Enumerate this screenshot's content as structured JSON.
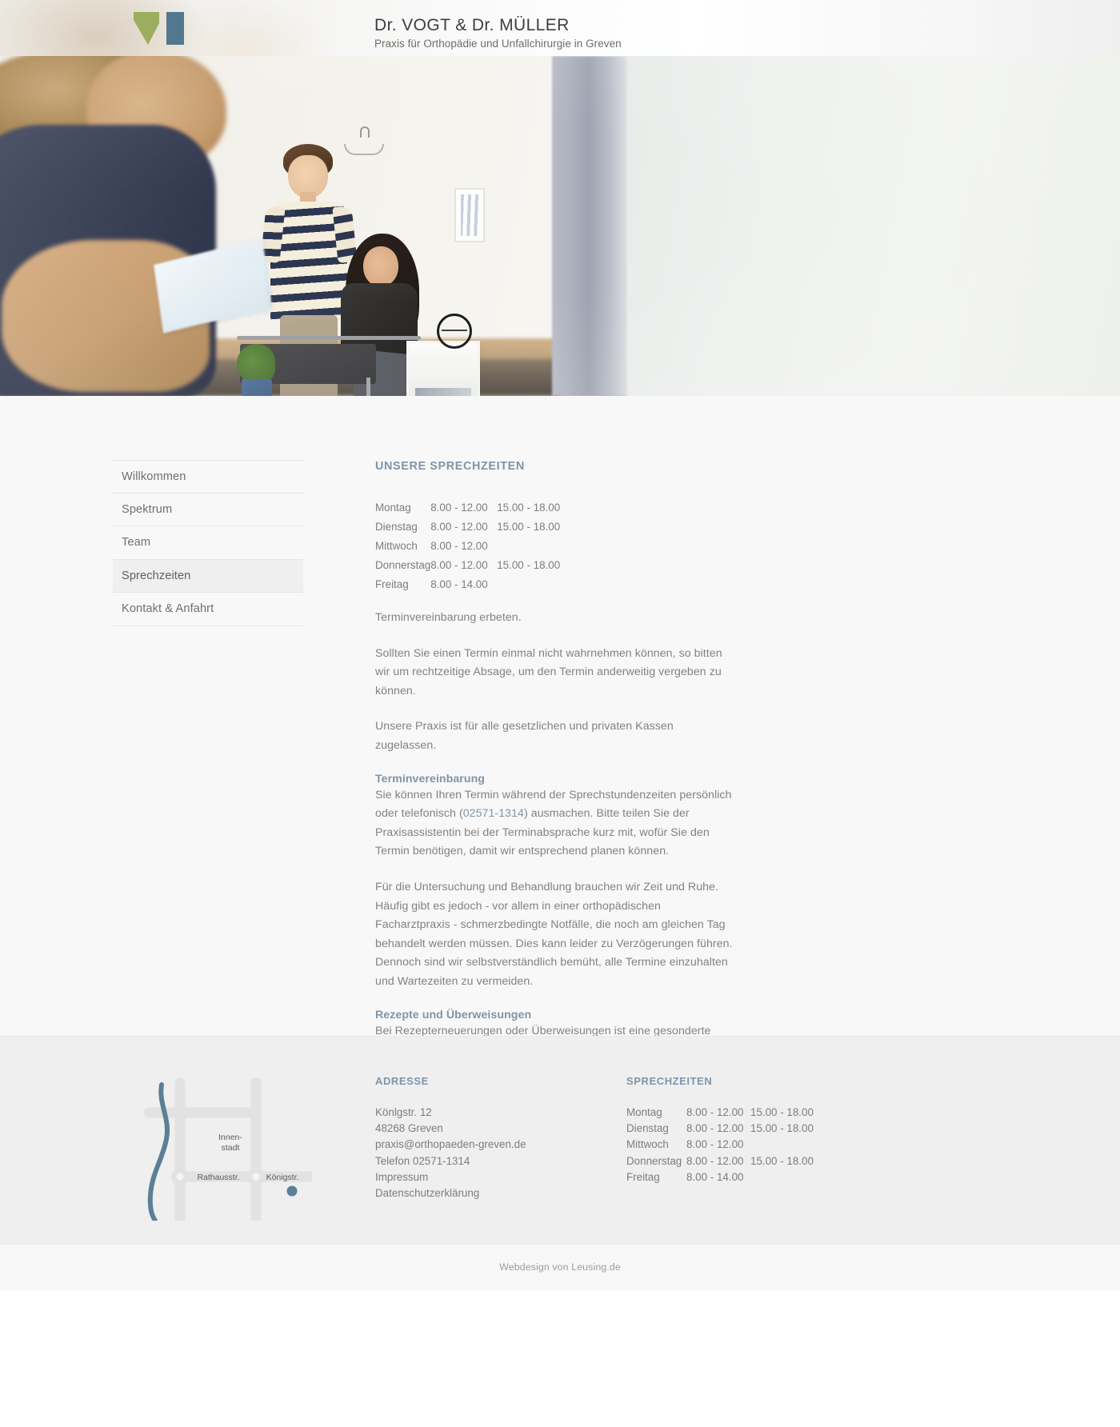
{
  "header": {
    "logo_name": "vogt-mueller-logo",
    "title": "Dr. VOGT  &  Dr. MÜLLER",
    "subtitle": "Praxis für Orthopädie und Unfallchirurgie in Greven"
  },
  "hero": {
    "alt": "Praxisteam begrüßt Patienten im Wartezimmer"
  },
  "sidebar": {
    "items": [
      {
        "label": "Willkommen",
        "active": false
      },
      {
        "label": "Spektrum",
        "active": false
      },
      {
        "label": "Team",
        "active": false
      },
      {
        "label": "Sprechzeiten",
        "active": true
      },
      {
        "label": "Kontakt & Anfahrt",
        "active": false
      }
    ]
  },
  "main": {
    "title": "UNSERE SPRECHZEITEN",
    "hours": [
      {
        "day": "Montag",
        "morning": "8.00 - 12.00",
        "afternoon": "15.00 - 18.00"
      },
      {
        "day": "Dienstag",
        "morning": "8.00 - 12.00",
        "afternoon": "15.00 - 18.00"
      },
      {
        "day": "Mittwoch",
        "morning": "8.00 - 12.00",
        "afternoon": ""
      },
      {
        "day": "Donnerstag",
        "morning": "8.00 - 12.00",
        "afternoon": "15.00 - 18.00"
      },
      {
        "day": "Freitag",
        "morning": "8.00 - 14.00",
        "afternoon": ""
      }
    ],
    "p_appointment_request": "Terminvereinbarung erbeten.",
    "p_cancellation": "Sollten Sie einen Termin einmal nicht wahrnehmen können, so bitten wir um rechtzeitige Absage, um den Termin anderweitig vergeben zu können.",
    "p_insurance": "Unsere Praxis ist für alle gesetzlichen und privaten Kassen zugelassen.",
    "h_terminvereinbarung": "Terminvereinbarung",
    "p_terminvereinbarung_a": "Sie können Ihren Termin während der Sprechstundenzeiten persönlich oder telefonisch (",
    "phone_link": "02571-1314",
    "p_terminvereinbarung_b": ") ausmachen. Bitte teilen Sie der Praxisassistentin bei der Terminabsprache kurz mit, wofür Sie den Termin benötigen, damit wir entsprechend planen können.",
    "p_waiting": "Für die Untersuchung und Behandlung brauchen wir Zeit und Ruhe. Häufig gibt es jedoch - vor allem in einer orthopädischen Facharztpraxis - schmerzbedingte Notfälle, die noch am gleichen Tag behandelt werden müssen. Dies kann leider zu Verzögerungen führen. Dennoch sind wir selbstverständlich bemüht, alle Termine einzuhalten und Wartezeiten zu vermeiden.",
    "h_rezepte": "Rezepte und Überweisungen",
    "p_rezepte_a": "Bei Rezepterneuerungen oder Überweisungen ist eine gesonderte Anmeldung nicht erforderlich. Wir empfehlen jedoch, eine telefonische Vorbestellung (",
    "p_rezepte_b": ")."
  },
  "footer": {
    "map": {
      "label_innenstadt_line1": "Innen-",
      "label_innenstadt_line2": "stadt",
      "label_rathausstr": "Rathausstr.",
      "label_koenigstr": "Königstr.",
      "river_color": "#5b7f96",
      "road_color": "#e2e2e2",
      "marker_color": "#5b7f96"
    },
    "address": {
      "heading": "ADRESSE",
      "street": "Könlgstr. 12",
      "city": "48268 Greven",
      "email": "praxis@orthopaeden-greven.de",
      "phone": "Telefon 02571-1314",
      "impressum": "Impressum",
      "datenschutz": "Datenschutzerklärung"
    },
    "hours": {
      "heading": "SPRECHZEITEN",
      "rows": [
        {
          "day": "Montag",
          "morning": "8.00 - 12.00",
          "afternoon": "15.00 - 18.00"
        },
        {
          "day": "Dienstag",
          "morning": "8.00 - 12.00",
          "afternoon": "15.00 - 18.00"
        },
        {
          "day": "Mittwoch",
          "morning": "8.00 - 12.00",
          "afternoon": ""
        },
        {
          "day": "Donnerstag",
          "morning": "8.00 - 12.00",
          "afternoon": "15.00 - 18.00"
        },
        {
          "day": "Freitag",
          "morning": "8.00 - 14.00",
          "afternoon": ""
        }
      ]
    }
  },
  "bottom": {
    "credit": "Webdesign von Leusing.de"
  },
  "colors": {
    "accent_blue": "#7e95aa",
    "logo_green": "#9cae5e",
    "logo_blue": "#51788f",
    "body_text": "#828282",
    "page_bg": "#f8f8f8",
    "footer_bg": "#efefef"
  }
}
